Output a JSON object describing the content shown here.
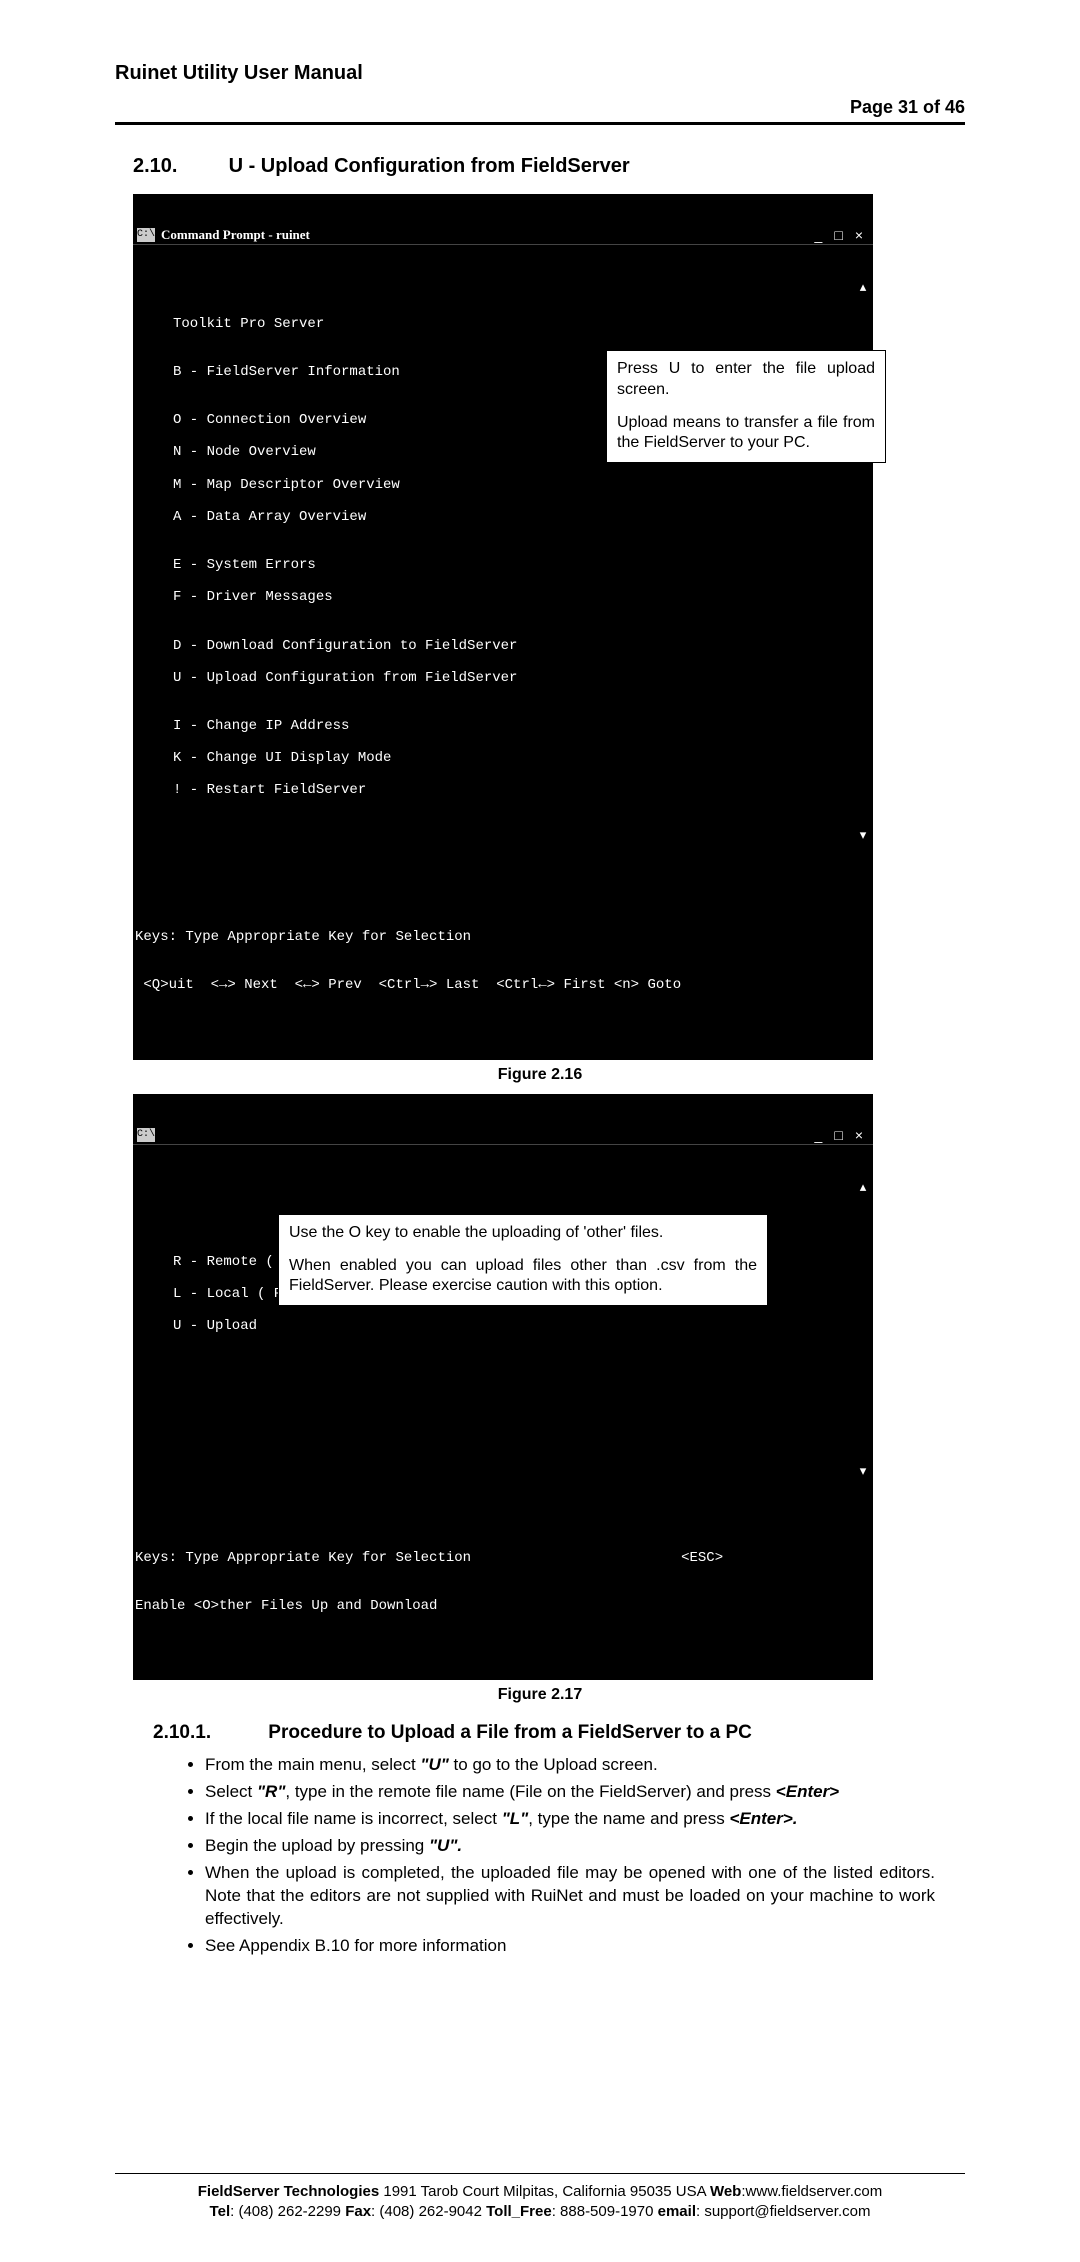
{
  "header": {
    "title": "Ruinet Utility User Manual",
    "page": "Page 31 of 46"
  },
  "section": {
    "num": "2.10.",
    "title": "U - Upload Configuration from FieldServer"
  },
  "term1": {
    "title": "Command Prompt - ruinet",
    "min": "_",
    "max": "□",
    "close": "×",
    "lines": [
      "Toolkit Pro Server",
      "",
      "B - FieldServer Information",
      "",
      "O - Connection Overview",
      "N - Node Overview",
      "M - Map Descriptor Overview",
      "A - Data Array Overview",
      "",
      "E - System Errors",
      "F - Driver Messages",
      "",
      "D - Download Configuration to FieldServer",
      "U - Upload Configuration from FieldServer",
      "",
      "I - Change IP Address",
      "K - Change UI Display Mode",
      "! - Restart FieldServer"
    ],
    "footer1": "Keys: Type Appropriate Key for Selection",
    "footer2": " <Q>uit  <→> Next  <←> Prev  <Ctrl→> Last  <Ctrl←> First <n> Goto"
  },
  "callout1": {
    "p1": "Press U to enter the file upload screen.",
    "p2": "Upload means to transfer a file from the FieldServer to your PC."
  },
  "fig1": "Figure 2.16",
  "term2": {
    "min": "_",
    "max": "□",
    "close": "×",
    "lines": [
      "R - Remote ( FieldServer ) Filename     config.csv",
      "L - Local ( PC ) Filename               config.csv",
      "U - Upload"
    ],
    "footer1": "Keys: Type Appropriate Key for Selection                         <ESC>",
    "footer2": "Enable <O>ther Files Up and Download"
  },
  "callout2": {
    "p1": "Use the O key to enable the uploading of 'other' files.",
    "p2": "When enabled you can upload files other than .csv from the FieldServer. Please exercise caution with this option."
  },
  "fig2": "Figure 2.17",
  "subsection": {
    "num": "2.10.1.",
    "title": "Procedure to Upload a File from a FieldServer to a PC"
  },
  "proc": {
    "b1a": "From the main menu, select ",
    "b1u": "\"U\"",
    "b1b": " to go to the Upload screen.",
    "b2a": "Select ",
    "b2r": "\"R\"",
    "b2b": ", type in the remote file name (File on the FieldServer) and press ",
    "b2e": "<Enter>",
    "b3a": "If the local file name is incorrect, select ",
    "b3l": "\"L\"",
    "b3b": ", type the name and press ",
    "b3e": "<Enter>.",
    "b4a": "Begin the upload by pressing ",
    "b4u": "\"U\".",
    "b5": "When the upload is completed, the uploaded file may be opened with one of the listed editors.  Note that the editors are not supplied with RuiNet and must be loaded on your machine to work effectively.",
    "b6": "See Appendix B.10 for more information"
  },
  "footer": {
    "l1a": "FieldServer Technologies",
    "l1b": " 1991 Tarob Court Milpitas, California 95035 USA  ",
    "l1w": "Web",
    "l1c": ":www.fieldserver.com",
    "l2t": "Tel",
    "l2a": ": (408) 262-2299   ",
    "l2f": "Fax",
    "l2b": ": (408) 262-9042   ",
    "l2tf": "Toll_Free",
    "l2c": ": 888-509-1970   ",
    "l2e": "email",
    "l2d": ": support@fieldserver.com"
  }
}
